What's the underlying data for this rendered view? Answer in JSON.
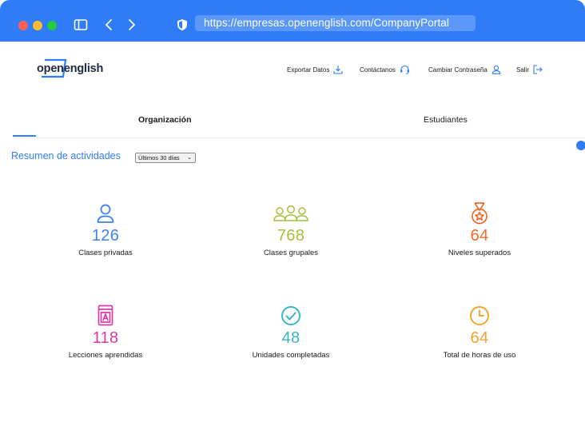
{
  "browser": {
    "url": "https://empresas.openenglish.com/CompanyPortal"
  },
  "header": {
    "logo_open": "open",
    "logo_english": "english",
    "nav": [
      {
        "label": "Exportar Datos",
        "icon": "download-icon"
      },
      {
        "label": "Contáctanos",
        "icon": "headset-icon"
      },
      {
        "label": "Cambiar Contraseña",
        "icon": "user-icon"
      },
      {
        "label": "Salir",
        "icon": "logout-icon"
      }
    ]
  },
  "tabs": [
    {
      "label": "Organización",
      "active": true
    },
    {
      "label": "Estudiantes",
      "active": false
    }
  ],
  "summary": {
    "title": "Resumen de actividades",
    "period": "Últimos 30 días"
  },
  "stats": [
    {
      "value": "126",
      "label": "Clases privadas",
      "color": "#3b83ea",
      "icon": "person-icon"
    },
    {
      "value": "768",
      "label": "Clases grupales",
      "color": "#a4c13c",
      "icon": "group-icon"
    },
    {
      "value": "64",
      "label": "Niveles superados",
      "color": "#ec6c2b",
      "icon": "medal-icon"
    },
    {
      "value": "118",
      "label": "Lecciones aprendidas",
      "color": "#d93aa6",
      "icon": "book-icon"
    },
    {
      "value": "48",
      "label": "Unidades completadas",
      "color": "#38b7c9",
      "icon": "check-circle-icon"
    },
    {
      "value": "64",
      "label": "Total de horas de uso",
      "color": "#f0a531",
      "icon": "clock-icon"
    }
  ],
  "colors": {
    "accent": "#2f7cf6",
    "logo_dark": "#1f2a44"
  }
}
